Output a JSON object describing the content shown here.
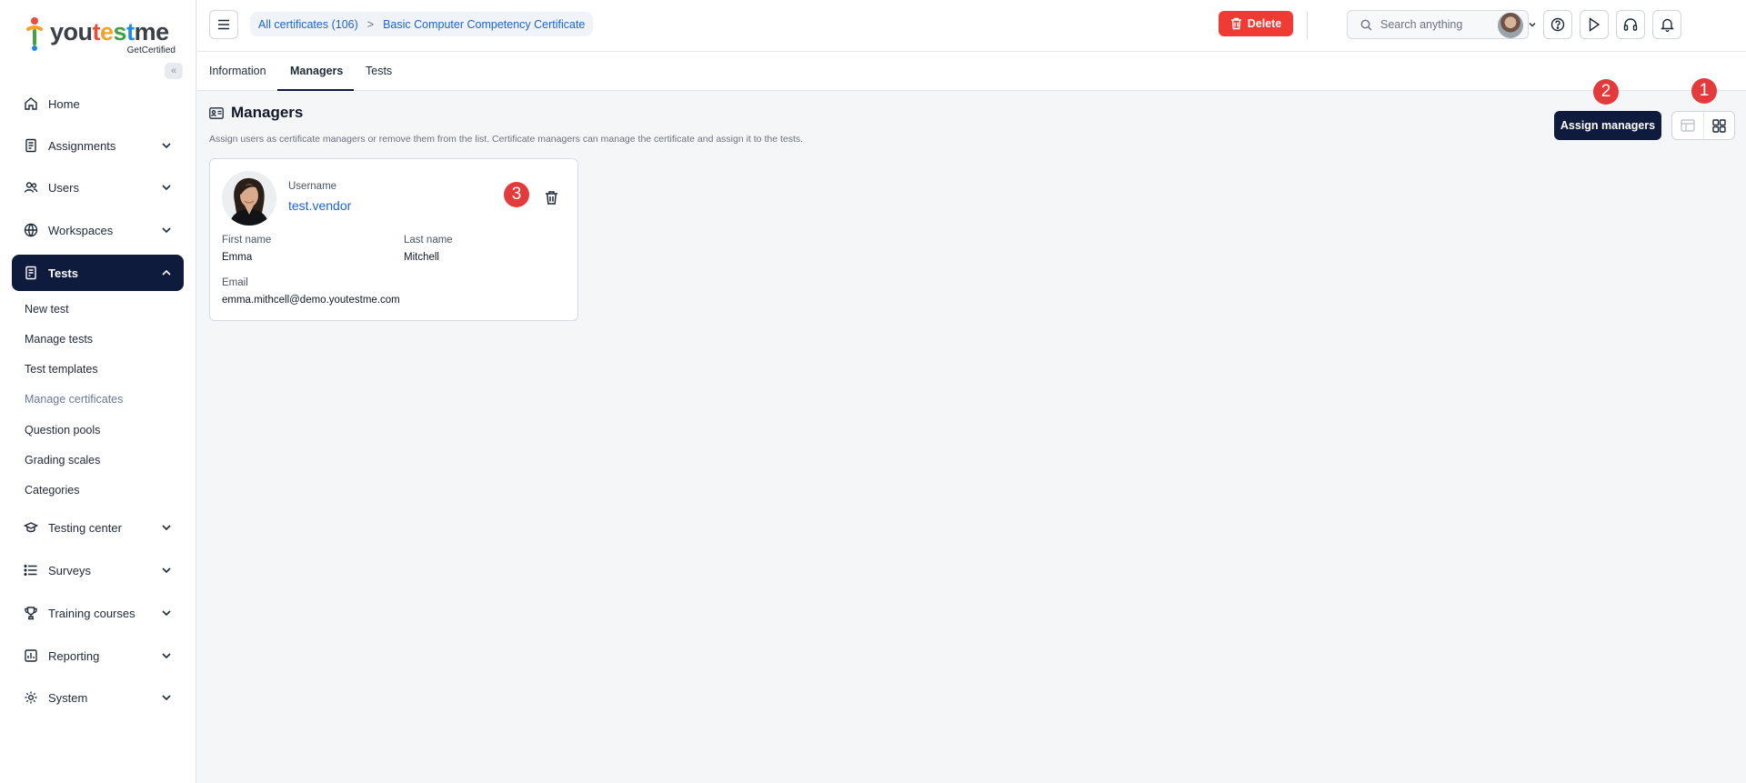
{
  "app": {
    "logo_text": [
      "you",
      "t",
      "e",
      "s",
      "t",
      "me"
    ],
    "logo_sub": "GetCertified"
  },
  "sidebar": {
    "items": [
      {
        "label": "Home",
        "icon": "home-icon"
      },
      {
        "label": "Assignments",
        "icon": "document-icon"
      },
      {
        "label": "Users",
        "icon": "users-icon"
      },
      {
        "label": "Workspaces",
        "icon": "globe-icon"
      },
      {
        "label": "Tests",
        "icon": "test-icon"
      },
      {
        "label": "Testing center",
        "icon": "testing-center-icon"
      },
      {
        "label": "Surveys",
        "icon": "list-icon"
      },
      {
        "label": "Training courses",
        "icon": "trophy-icon"
      },
      {
        "label": "Reporting",
        "icon": "chart-icon"
      },
      {
        "label": "System",
        "icon": "gear-icon"
      }
    ],
    "tests_subitems": [
      "New test",
      "Manage tests",
      "Test templates",
      "Manage certificates",
      "Question pools",
      "Grading scales",
      "Categories"
    ]
  },
  "topbar": {
    "breadcrumb": [
      "All certificates (106)",
      ">",
      "Basic Computer Competency Certificate"
    ],
    "delete_label": "Delete",
    "search_placeholder": "Search anything"
  },
  "tabs": [
    "Information",
    "Managers",
    "Tests"
  ],
  "main": {
    "title": "Managers",
    "description": "Assign users as certificate managers or remove them from the list. Certificate managers can manage the certificate and assign it to the tests.",
    "assign_label": "Assign managers",
    "badges": [
      "1",
      "2",
      "3"
    ]
  },
  "manager": {
    "username_label": "Username",
    "username": "test.vendor",
    "first_name_label": "First name",
    "first_name": "Emma",
    "last_name_label": "Last name",
    "last_name": "Mitchell",
    "email_label": "Email",
    "email": "emma.mithcell@demo.youtestme.com"
  },
  "colors": {
    "primary": "#0f1b3d",
    "danger": "#ef3b33",
    "link": "#1d63d6",
    "badge": "#e33b3b"
  }
}
